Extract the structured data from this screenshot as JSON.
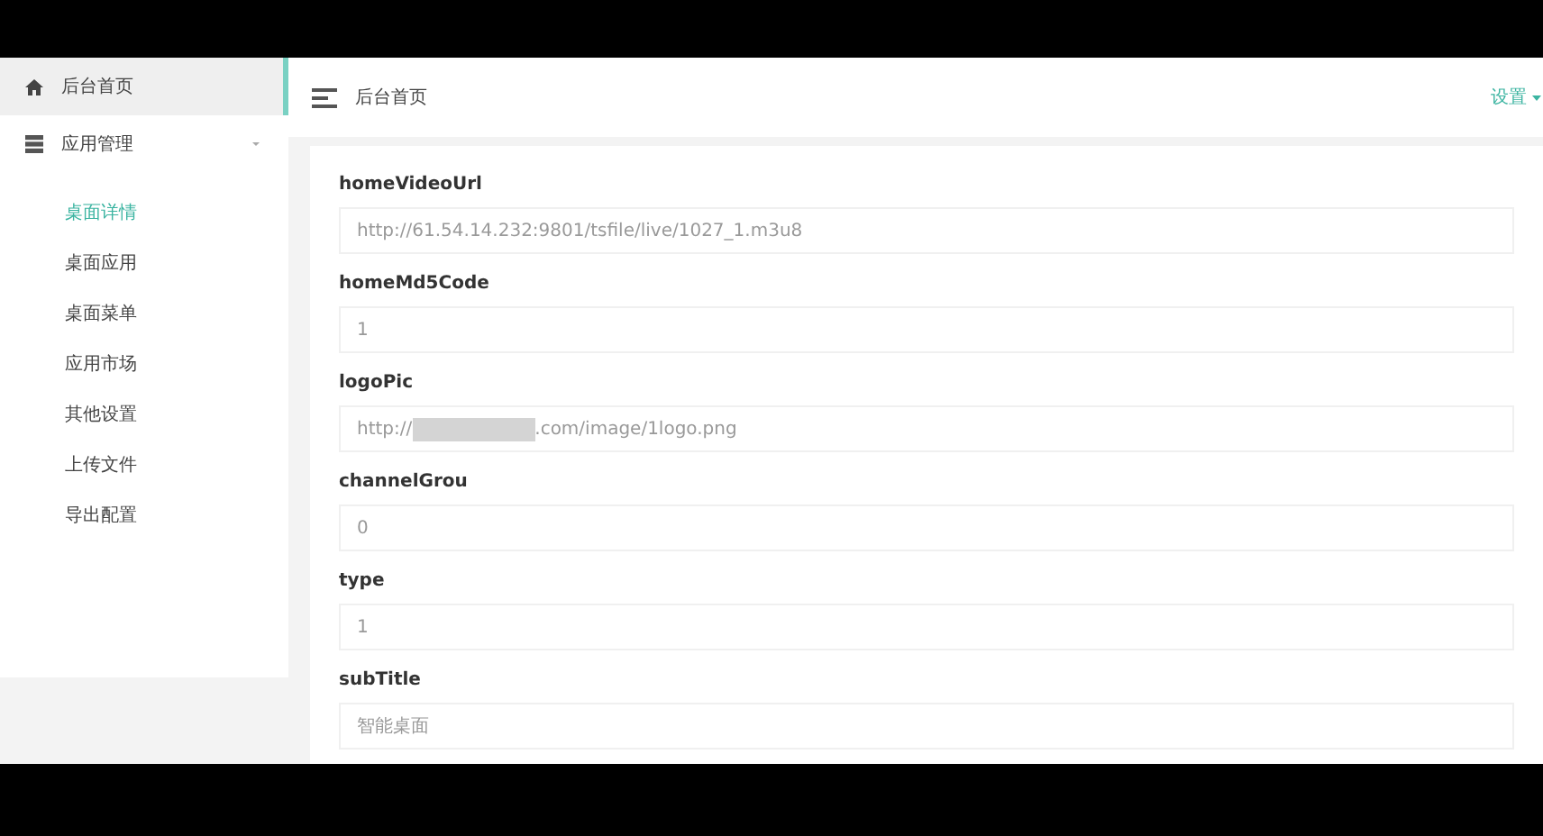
{
  "sidebar": {
    "items": [
      {
        "label": "后台首页",
        "kind": "link",
        "selected": true
      },
      {
        "label": "应用管理",
        "kind": "group",
        "selected": false,
        "expanded": true,
        "children": [
          {
            "label": "桌面详情",
            "selected": true
          },
          {
            "label": "桌面应用",
            "selected": false
          },
          {
            "label": "桌面菜单",
            "selected": false
          },
          {
            "label": "应用市场",
            "selected": false
          },
          {
            "label": "其他设置",
            "selected": false
          },
          {
            "label": "上传文件",
            "selected": false
          },
          {
            "label": "导出配置",
            "selected": false
          }
        ]
      }
    ]
  },
  "header": {
    "title": "后台首页",
    "menu": "设置"
  },
  "form": {
    "fields": [
      {
        "label": "homeVideoUrl",
        "value": "http://61.54.14.232:9801/tsfile/live/1027_1.m3u8"
      },
      {
        "label": "homeMd5Code",
        "value": "1"
      },
      {
        "label": "logoPic",
        "value": "http://",
        "value_after_redaction": ".com/image/1logo.png"
      },
      {
        "label": "channelGrou",
        "value": "0"
      },
      {
        "label": "type",
        "value": "1"
      },
      {
        "label": "subTitle",
        "value": "智能桌面"
      }
    ]
  }
}
